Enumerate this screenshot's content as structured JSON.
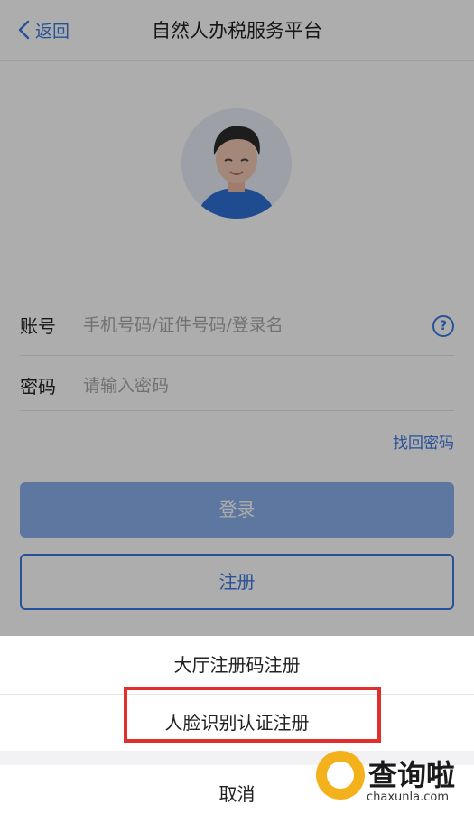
{
  "header": {
    "back_label": "返回",
    "title": "自然人办税服务平台"
  },
  "form": {
    "account_label": "账号",
    "account_placeholder": "手机号码/证件号码/登录名",
    "password_label": "密码",
    "password_placeholder": "请输入密码",
    "help_symbol": "?",
    "forgot_password": "找回密码",
    "login_button": "登录",
    "register_button": "注册"
  },
  "action_sheet": {
    "items": [
      {
        "label": "大厅注册码注册"
      },
      {
        "label": "人脸识别认证注册"
      }
    ],
    "cancel_label": "取消"
  },
  "watermark": {
    "name": "查询啦",
    "url": "chaxunla.com"
  },
  "colors": {
    "accent": "#3a78e0",
    "highlight_box": "#e0302d",
    "watermark_icon": "#f3b21c"
  }
}
